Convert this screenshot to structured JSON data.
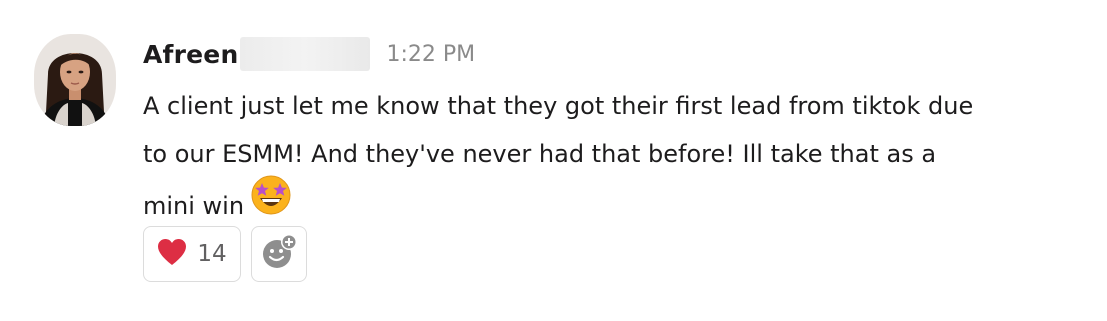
{
  "message": {
    "sender": "Afreen",
    "timestamp": "1:22 PM",
    "text_lines": [
      "A client just let me know that they got their first lead from tiktok due",
      "to our ESMM! And they've never had that before! Ill take that as a",
      "mini win"
    ],
    "inline_emoji": "star-struck-icon"
  },
  "reactions": [
    {
      "icon": "red-heart-icon",
      "count": "14"
    }
  ],
  "add_reaction": {
    "icon": "add-reaction-icon"
  },
  "colors": {
    "heart": "#dd2e44",
    "emoji_face": "#fbb21c",
    "timestamp": "#8a8a8a",
    "border": "#dcdcdc"
  }
}
